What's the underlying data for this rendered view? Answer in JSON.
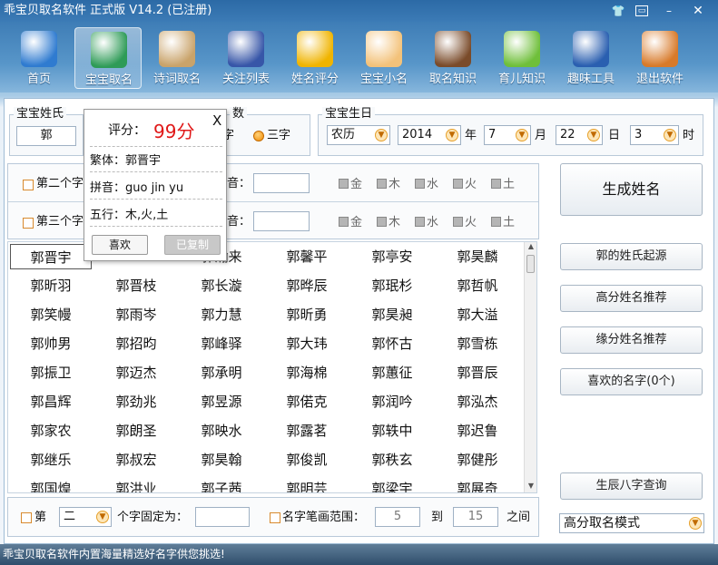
{
  "window": {
    "title": "乖宝贝取名软件 正式版 V14.2 (已注册)",
    "controls": [
      "shirt-icon",
      "restore-icon",
      "minimize-icon",
      "close-icon"
    ]
  },
  "toolbar": {
    "items": [
      {
        "label": "首页",
        "icon": "monitor-chart-icon",
        "color": "#2f7bd0"
      },
      {
        "label": "宝宝取名",
        "icon": "edit-screen-icon",
        "color": "#2e9b57",
        "active": true
      },
      {
        "label": "诗词取名",
        "icon": "scroll-icon",
        "color": "#c9a36a"
      },
      {
        "label": "关注列表",
        "icon": "star-badge-icon",
        "color": "#3756a8"
      },
      {
        "label": "姓名评分",
        "icon": "star-pencil-icon",
        "color": "#f0b400"
      },
      {
        "label": "宝宝小名",
        "icon": "baby-face-icon",
        "color": "#f3c27a"
      },
      {
        "label": "取名知识",
        "icon": "books-icon",
        "color": "#7a4b2a"
      },
      {
        "label": "育儿知识",
        "icon": "sunflower-baby-icon",
        "color": "#6fbf3a"
      },
      {
        "label": "趣味工具",
        "icon": "atv-icon",
        "color": "#2a5fb0"
      },
      {
        "label": "退出软件",
        "icon": "exit-door-icon",
        "color": "#d87a2a"
      }
    ]
  },
  "surname": {
    "title": "宝宝姓氏",
    "value": "郭"
  },
  "wordcount": {
    "title_partial": "数",
    "option_two": "字",
    "option_three": "三字"
  },
  "birth": {
    "title": "宝宝生日",
    "calendar": "农历",
    "year": "2014",
    "year_unit": "年",
    "month": "7",
    "month_unit": "月",
    "day": "22",
    "day_unit": "日",
    "hour": "3",
    "hour_unit": "时"
  },
  "filters": [
    {
      "label": "第二个字",
      "pinyin_label": "音：",
      "elements": [
        "金",
        "木",
        "水",
        "火",
        "土"
      ]
    },
    {
      "label": "第三个字",
      "pinyin_label": "音：",
      "elements": [
        "金",
        "木",
        "水",
        "火",
        "土"
      ]
    }
  ],
  "popup": {
    "score_label": "评分：",
    "score": "99分",
    "close": "X",
    "traditional": "繁体：郭晋宇",
    "pinyin": "拼音：guo jin yu",
    "wuxing": "五行：木,火,土",
    "like_button": "喜欢",
    "copied_button": "已复制"
  },
  "names": [
    "郭晋宇",
    "",
    "郭瀚来",
    "郭馨平",
    "郭亭安",
    "郭昊麟",
    "郭昕羽",
    "郭晋枝",
    "郭长漩",
    "郭晔辰",
    "郭珉杉",
    "郭哲帆",
    "郭笑幔",
    "郭雨岑",
    "郭力慧",
    "郭昕勇",
    "郭昊昶",
    "郭大溢",
    "郭帅男",
    "郭招昀",
    "郭峰驿",
    "郭大玮",
    "郭怀古",
    "郭雪栋",
    "郭振卫",
    "郭迈杰",
    "郭承明",
    "郭海棉",
    "郭蕙征",
    "郭晋辰",
    "郭昌辉",
    "郭劲兆",
    "郭昱源",
    "郭偌克",
    "郭润吟",
    "郭泓杰",
    "郭家农",
    "郭朗圣",
    "郭映水",
    "郭露茗",
    "郭轶中",
    "郭迟鲁",
    "郭继乐",
    "郭叔宏",
    "郭昊翰",
    "郭俊凯",
    "郭秩玄",
    "郭健彤",
    "郭国煌",
    "郭洪业",
    "郭子茜",
    "郭明芸",
    "郭梁宇",
    "郭展奇"
  ],
  "bottom": {
    "fix_prefix": "第",
    "fix_position": "二",
    "fix_suffix": "个字固定为：",
    "fix_value": "",
    "stroke_label": "名字笔画范围：",
    "stroke_from": "5",
    "stroke_to_label": "到",
    "stroke_to": "15",
    "stroke_suffix": "之间"
  },
  "right_buttons": {
    "generate": "生成姓名",
    "origin": "郭的姓氏起源",
    "high_score": "高分姓名推荐",
    "fate": "缘分姓名推荐",
    "favorites": "喜欢的名字(0个)",
    "bazi": "生辰八字查询",
    "mode": "高分取名模式"
  },
  "status": "乖宝贝取名软件内置海量精选好名字供您挑选!"
}
